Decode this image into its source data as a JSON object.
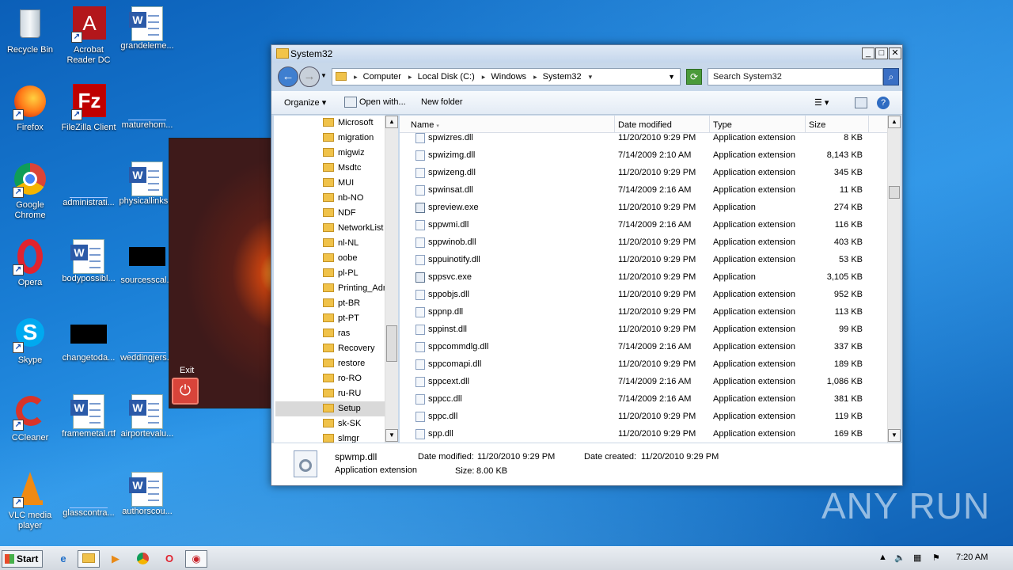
{
  "desktop": {
    "icons": [
      {
        "label": "Recycle Bin",
        "icon": "recycle-bin-icon"
      },
      {
        "label": "Acrobat Reader DC",
        "icon": "acrobat-icon"
      },
      {
        "label": "grandeleme...",
        "icon": "word-doc-icon"
      },
      {
        "label": "Firefox",
        "icon": "firefox-icon"
      },
      {
        "label": "FileZilla Client",
        "icon": "filezilla-icon"
      },
      {
        "label": "maturehom...",
        "icon": "blank-file-icon"
      },
      {
        "label": "Google Chrome",
        "icon": "chrome-icon"
      },
      {
        "label": "administrati...",
        "icon": "blank-file-icon"
      },
      {
        "label": "physicallinks...",
        "icon": "word-doc-icon"
      },
      {
        "label": "Opera",
        "icon": "opera-icon"
      },
      {
        "label": "bodypossibl...",
        "icon": "word-doc-icon"
      },
      {
        "label": "sourcesscal...",
        "icon": "black-file-icon"
      },
      {
        "label": "Skype",
        "icon": "skype-icon"
      },
      {
        "label": "changetoda...",
        "icon": "black-file-icon"
      },
      {
        "label": "weddingjers...",
        "icon": "blank-file-icon"
      },
      {
        "label": "CCleaner",
        "icon": "ccleaner-icon"
      },
      {
        "label": "framemetal.rtf",
        "icon": "word-doc-icon"
      },
      {
        "label": "airportevalu...",
        "icon": "word-doc-icon"
      },
      {
        "label": "VLC media player",
        "icon": "vlc-icon"
      },
      {
        "label": "glasscontra...",
        "icon": "blank-file-icon"
      },
      {
        "label": "authorscou...",
        "icon": "word-doc-icon"
      }
    ],
    "video_exit_label": "Exit",
    "watermark": "ANY RUN"
  },
  "window": {
    "title": "System32",
    "breadcrumb": [
      "Computer",
      "Local Disk (C:)",
      "Windows",
      "System32"
    ],
    "search_placeholder": "Search System32",
    "toolbar": {
      "organize": "Organize",
      "open_with": "Open with...",
      "new_folder": "New folder"
    },
    "nav_folders": [
      "Microsoft",
      "migration",
      "migwiz",
      "Msdtc",
      "MUI",
      "nb-NO",
      "NDF",
      "NetworkList",
      "nl-NL",
      "oobe",
      "pl-PL",
      "Printing_Adm",
      "pt-BR",
      "pt-PT",
      "ras",
      "Recovery",
      "restore",
      "ro-RO",
      "ru-RU",
      "Setup",
      "sk-SK",
      "slmgr"
    ],
    "selected_nav": "Setup",
    "columns": {
      "name": "Name",
      "date": "Date modified",
      "type": "Type",
      "size": "Size"
    },
    "files": [
      {
        "name": "spwizres.dll",
        "date": "11/20/2010 9:29 PM",
        "type": "Application extension",
        "size": "8 KB",
        "kind": "dll"
      },
      {
        "name": "spwizimg.dll",
        "date": "7/14/2009 2:10 AM",
        "type": "Application extension",
        "size": "8,143 KB",
        "kind": "dll"
      },
      {
        "name": "spwizeng.dll",
        "date": "11/20/2010 9:29 PM",
        "type": "Application extension",
        "size": "345 KB",
        "kind": "dll"
      },
      {
        "name": "spwinsat.dll",
        "date": "7/14/2009 2:16 AM",
        "type": "Application extension",
        "size": "11 KB",
        "kind": "dll"
      },
      {
        "name": "spreview.exe",
        "date": "11/20/2010 9:29 PM",
        "type": "Application",
        "size": "274 KB",
        "kind": "exe"
      },
      {
        "name": "sppwmi.dll",
        "date": "7/14/2009 2:16 AM",
        "type": "Application extension",
        "size": "116 KB",
        "kind": "dll"
      },
      {
        "name": "sppwinob.dll",
        "date": "11/20/2010 9:29 PM",
        "type": "Application extension",
        "size": "403 KB",
        "kind": "dll"
      },
      {
        "name": "sppuinotify.dll",
        "date": "11/20/2010 9:29 PM",
        "type": "Application extension",
        "size": "53 KB",
        "kind": "dll"
      },
      {
        "name": "sppsvc.exe",
        "date": "11/20/2010 9:29 PM",
        "type": "Application",
        "size": "3,105 KB",
        "kind": "exe"
      },
      {
        "name": "sppobjs.dll",
        "date": "11/20/2010 9:29 PM",
        "type": "Application extension",
        "size": "952 KB",
        "kind": "dll"
      },
      {
        "name": "sppnp.dll",
        "date": "11/20/2010 9:29 PM",
        "type": "Application extension",
        "size": "113 KB",
        "kind": "dll"
      },
      {
        "name": "sppinst.dll",
        "date": "11/20/2010 9:29 PM",
        "type": "Application extension",
        "size": "99 KB",
        "kind": "dll"
      },
      {
        "name": "sppcommdlg.dll",
        "date": "7/14/2009 2:16 AM",
        "type": "Application extension",
        "size": "337 KB",
        "kind": "dll"
      },
      {
        "name": "sppcomapi.dll",
        "date": "11/20/2010 9:29 PM",
        "type": "Application extension",
        "size": "189 KB",
        "kind": "dll"
      },
      {
        "name": "sppcext.dll",
        "date": "7/14/2009 2:16 AM",
        "type": "Application extension",
        "size": "1,086 KB",
        "kind": "dll"
      },
      {
        "name": "sppcc.dll",
        "date": "7/14/2009 2:16 AM",
        "type": "Application extension",
        "size": "381 KB",
        "kind": "dll"
      },
      {
        "name": "sppc.dll",
        "date": "11/20/2010 9:29 PM",
        "type": "Application extension",
        "size": "119 KB",
        "kind": "dll"
      },
      {
        "name": "spp.dll",
        "date": "11/20/2010 9:29 PM",
        "type": "Application extension",
        "size": "169 KB",
        "kind": "dll"
      }
    ],
    "details": {
      "name": "spwmp.dll",
      "type": "Application extension",
      "date_modified_label": "Date modified:",
      "date_modified": "11/20/2010 9:29 PM",
      "date_created_label": "Date created:",
      "date_created": "11/20/2010 9:29 PM",
      "size_label": "Size:",
      "size": "8.00 KB"
    }
  },
  "taskbar": {
    "start_label": "Start",
    "apps": [
      "ie-icon",
      "explorer-icon",
      "media-player-icon",
      "chrome-icon",
      "opera-icon",
      "recorder-icon"
    ],
    "clock": "7:20 AM"
  },
  "colors": {
    "selection": "#d9d9d9",
    "desktop": "#1a7fd6"
  }
}
